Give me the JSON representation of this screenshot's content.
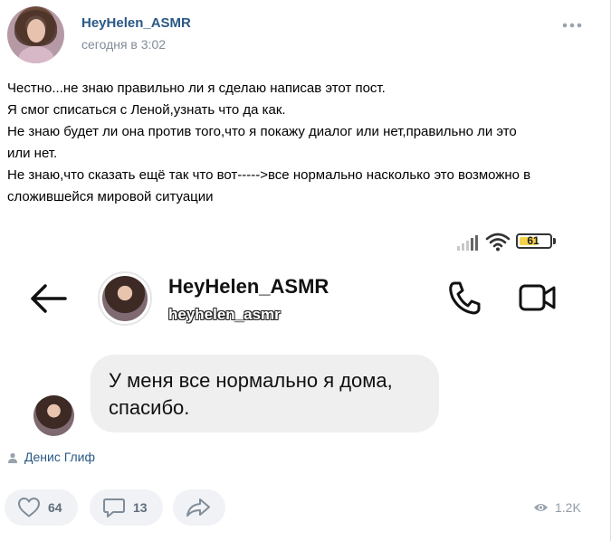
{
  "post": {
    "author": "HeyHelen_ASMR",
    "time": "сегодня в 3:02",
    "text_lines": [
      "Честно...не знаю правильно ли я сделаю написав этот пост.",
      "Я смог списаться с Леной,узнать что да как.",
      "Не знаю будет ли она против того,что я покажу диалог или нет,правильно ли это",
      "или нет.",
      "Не знаю,что сказать ещё так что вот----->все нормально насколько это возможно в",
      "сложившейся мировой ситуации"
    ],
    "signer": "Денис Глиф"
  },
  "embedded_chat": {
    "battery_percent": "61",
    "contact_name": "HeyHelen_ASMR",
    "contact_handle": "heyhelen_asmr",
    "message_lines": [
      "У меня все нормально я дома,",
      "спасибо."
    ]
  },
  "actions": {
    "likes": "64",
    "comments": "13",
    "views": "1.2K"
  },
  "icons": {
    "more": "more-dots-icon",
    "like": "heart-icon",
    "comment": "comment-bubble-icon",
    "share": "share-arrow-icon",
    "views": "eye-icon",
    "signer": "person-icon"
  },
  "colors": {
    "link": "#2a5885",
    "muted": "#818c99",
    "action_bg": "#f0f2f5"
  }
}
